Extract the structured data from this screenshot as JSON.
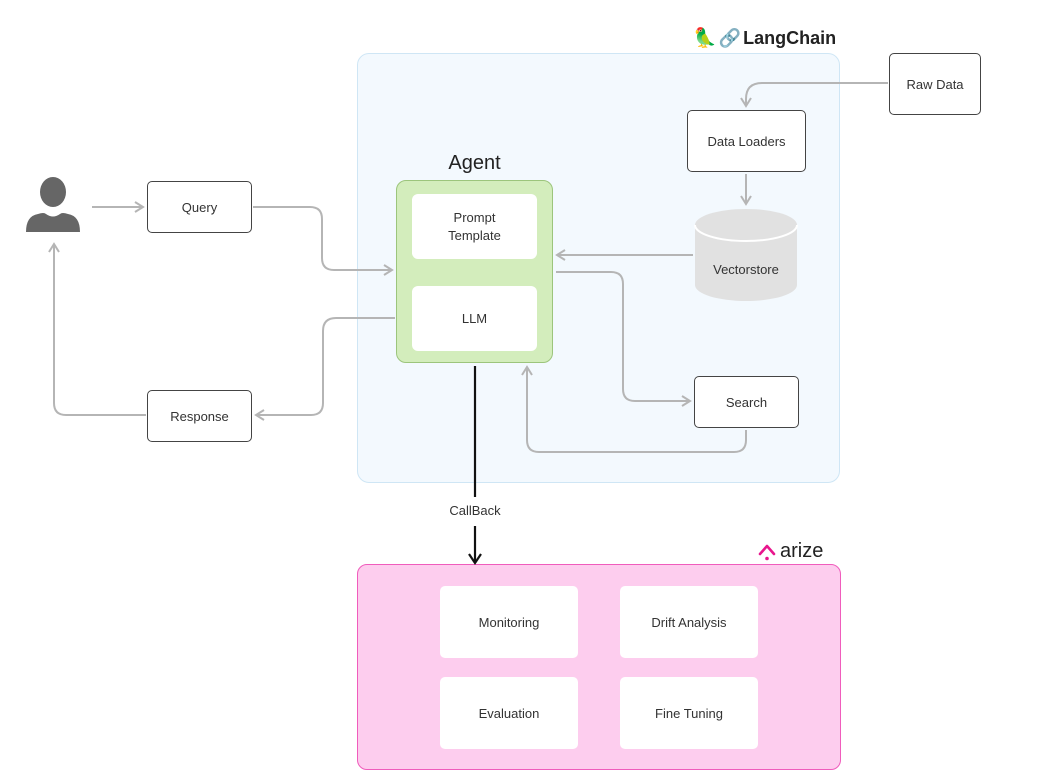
{
  "langchain": {
    "brand_label": "LangChain",
    "brand_icons": [
      "parrot-icon",
      "link-icon"
    ]
  },
  "arize": {
    "brand_label": "arize",
    "brand_icon": "arize-logo-icon",
    "accent_color": "#e8168d",
    "tiles": [
      {
        "label": "Monitoring"
      },
      {
        "label": "Drift Analysis"
      },
      {
        "label": "Evaluation"
      },
      {
        "label": "Fine Tuning"
      }
    ]
  },
  "user": {
    "icon": "user-icon"
  },
  "nodes": {
    "query": "Query",
    "response": "Response",
    "raw_data": "Raw Data",
    "data_loaders": "Data Loaders",
    "vectorstore": "Vectorstore",
    "search": "Search"
  },
  "agent": {
    "title": "Agent",
    "prompt_template": "Prompt Template",
    "llm": "LLM",
    "color": "#d3edbc"
  },
  "edges": {
    "callback_label": "CallBack"
  },
  "colors": {
    "langchain_region": "#f3f9fe",
    "arize_region": "#fdcdee",
    "arrow_gray": "#b5b5b5"
  }
}
